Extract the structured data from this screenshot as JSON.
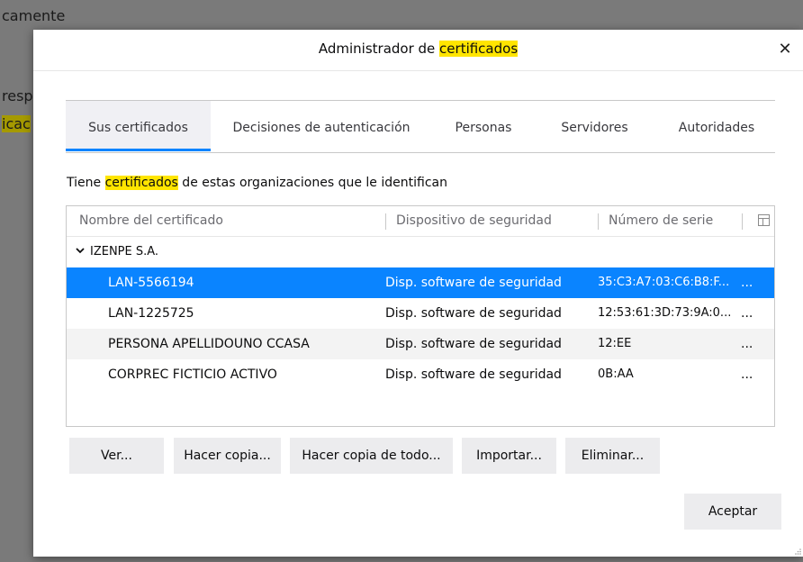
{
  "background": {
    "line1": "camente",
    "line2": "resp",
    "line3": "icac"
  },
  "dialog": {
    "title_prefix": "Administrador de ",
    "title_highlight": "certificados",
    "close_glyph": "✕"
  },
  "tabs": [
    {
      "label": "Sus certificados",
      "active": true
    },
    {
      "label": "Decisiones de autenticación",
      "active": false
    },
    {
      "label": "Personas",
      "active": false
    },
    {
      "label": "Servidores",
      "active": false
    },
    {
      "label": "Autoridades",
      "active": false
    }
  ],
  "description": {
    "prefix": "Tiene ",
    "highlight": "certificados",
    "suffix": " de estas organizaciones que le identifican"
  },
  "table": {
    "columns": [
      "Nombre del certificado",
      "Dispositivo de seguridad",
      "Número de serie"
    ],
    "column_picker_icon": "column-picker-icon",
    "group": {
      "name": "IZENPE S.A.",
      "expanded": true
    },
    "rows": [
      {
        "name": "LAN-5566194",
        "device": "Disp. software de seguridad",
        "serial": "35:C3:A7:03:C6:B8:F...",
        "more": "...",
        "selected": true
      },
      {
        "name": "LAN-1225725",
        "device": "Disp. software de seguridad",
        "serial": "12:53:61:3D:73:9A:0...",
        "more": "...",
        "selected": false
      },
      {
        "name": "PERSONA APELLIDOUNO CCASA",
        "device": "Disp. software de seguridad",
        "serial": "12:EE",
        "more": "...",
        "selected": false
      },
      {
        "name": "CORPREC FICTICIO ACTIVO",
        "device": "Disp. software de seguridad",
        "serial": "0B:AA",
        "more": "...",
        "selected": false
      }
    ]
  },
  "buttons": {
    "ver": "Ver...",
    "hacer_copia": "Hacer copia...",
    "hacer_copia_todo": "Hacer copia de todo...",
    "importar": "Importar...",
    "eliminar": "Eliminar...",
    "aceptar": "Aceptar"
  },
  "colors": {
    "accent": "#0a84ff",
    "highlight": "#ffe500"
  }
}
